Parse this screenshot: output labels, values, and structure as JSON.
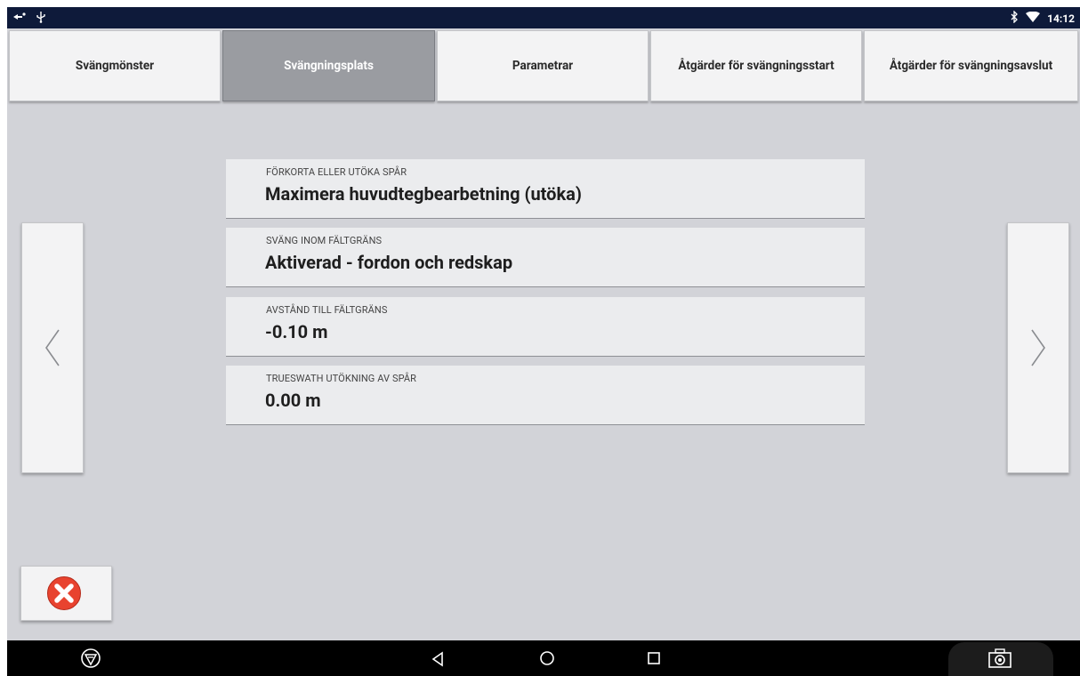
{
  "status_bar": {
    "left_icons": [
      "navigation-icon",
      "usb-icon"
    ],
    "right_icons": [
      "bluetooth-icon",
      "wifi-icon"
    ],
    "time": "14:12"
  },
  "tabs": [
    {
      "label": "Svängmönster",
      "active": false
    },
    {
      "label": "Svängningsplats",
      "active": true
    },
    {
      "label": "Parametrar",
      "active": false
    },
    {
      "label": "Åtgärder för svängningsstart",
      "active": false
    },
    {
      "label": "Åtgärder för svängningsavslut",
      "active": false
    }
  ],
  "fields": [
    {
      "label": "FÖRKORTA ELLER UTÖKA SPÅR",
      "value": "Maximera huvudtegbearbetning (utöka)"
    },
    {
      "label": "SVÄNG INOM FÄLTGRÄNS",
      "value": "Aktiverad - fordon och redskap"
    },
    {
      "label": "AVSTÅND TILL FÄLTGRÄNS",
      "value": "-0.10 m"
    },
    {
      "label": "TRUESWATH UTÖKNING AV SPÅR",
      "value": "0.00 m"
    }
  ],
  "nav_buttons": {
    "previous_icon": "chevron-left-icon",
    "next_icon": "chevron-right-icon"
  },
  "close_button": {
    "icon": "close-red-icon",
    "color": "#e8432f"
  },
  "system_nav": [
    "logo-icon",
    "back-icon",
    "home-icon",
    "recents-icon",
    "camera-icon"
  ],
  "colors": {
    "active_tab": "#9a9ca1",
    "background": "#d2d3d8",
    "status_bar": "#0e1a3a"
  }
}
